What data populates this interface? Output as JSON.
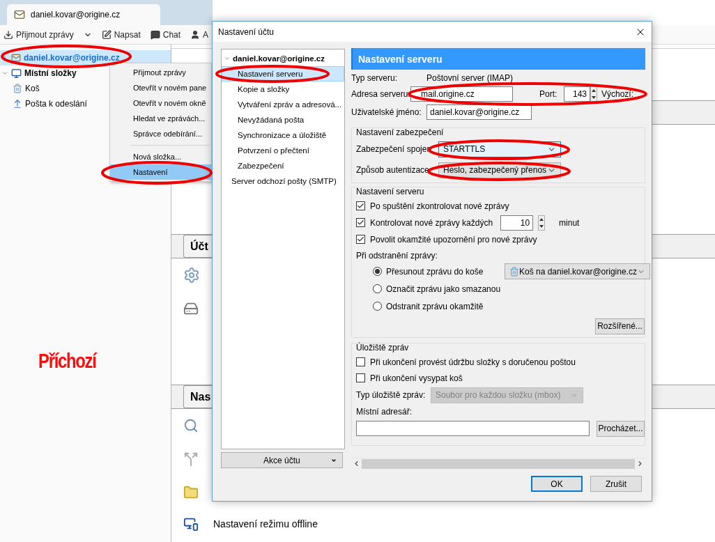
{
  "tab": {
    "title": "daniel.kovar@origine.cz"
  },
  "toolbar": [
    {
      "kind": "get",
      "label": "Přijmout zprávy"
    },
    {
      "kind": "menu"
    },
    {
      "kind": "write",
      "label": "Napsat"
    },
    {
      "kind": "chat",
      "label": "Chat"
    },
    {
      "kind": "contacts",
      "label": "A"
    }
  ],
  "folders": [
    {
      "kind": "account",
      "label": "daniel.kovar@origine.cz",
      "selected": true,
      "expanded": false
    },
    {
      "kind": "local",
      "label": "Místní složky",
      "selected": false,
      "expanded": true,
      "children": [
        {
          "kind": "trash",
          "label": "Koš",
          "selected": false
        },
        {
          "kind": "outbox",
          "label": "Pošta k odeslání",
          "selected": false
        }
      ]
    }
  ],
  "context_menu": [
    {
      "kind": "item",
      "label": "Přijmout zprávy",
      "selected": false
    },
    {
      "kind": "item",
      "label": "Otevřít v novém pane",
      "selected": false
    },
    {
      "kind": "item",
      "label": "Otevřít v novém okně",
      "selected": false
    },
    {
      "kind": "item",
      "label": "Hledat ve zprávách...",
      "selected": false
    },
    {
      "kind": "item",
      "label": "Správce odebírání...",
      "selected": false
    },
    {
      "kind": "separator"
    },
    {
      "kind": "item",
      "label": "Nová složka...",
      "selected": false
    },
    {
      "kind": "item",
      "label": "Nastavení",
      "selected": true
    }
  ],
  "content": {
    "sections": [
      "Účt",
      "Nas"
    ],
    "offline_link": "Nastavení režimu offline"
  },
  "annotation": "Příchozí",
  "dialog": {
    "title": "Nastavení účtu",
    "tree": {
      "account": "daniel.kovar@origine.cz",
      "expanded": true,
      "items": [
        {
          "label": "Nastavení serveru",
          "selected": true
        },
        {
          "label": "Kopie a složky",
          "selected": false
        },
        {
          "label": "Vytváření zpráv a adresová...",
          "selected": false
        },
        {
          "label": "Nevyžádaná pošta",
          "selected": false
        },
        {
          "label": "Synchronizace a úložiště",
          "selected": false
        },
        {
          "label": "Potvrzení o přečtení",
          "selected": false
        },
        {
          "label": "Zabezpečení",
          "selected": false
        }
      ],
      "other": "Server odchozí pošty (SMTP)"
    },
    "account_actions": "Akce účtu",
    "header": "Nastavení serveru",
    "server_type": {
      "label": "Typ serveru:",
      "value": "Poštovní server (IMAP)"
    },
    "server_address": {
      "label": "Adresa serveru:",
      "value": "mail.origine.cz"
    },
    "port": {
      "label": "Port:",
      "value": "143",
      "default_label": "Výchozí:"
    },
    "username": {
      "label": "Uživatelské jméno:",
      "value": "daniel.kovar@origine.cz"
    },
    "security": {
      "title": "Nastavení zabezpečení",
      "rows": [
        {
          "label": "Zabezpečení spojen",
          "value": "STARTTLS",
          "focused": true
        },
        {
          "label": "Způsob autentizace",
          "value": "Heslo, zabezpečený přenos",
          "focused": false
        }
      ]
    },
    "server_settings": {
      "title": "Nastavení serveru",
      "checks": [
        {
          "kind": "plain",
          "label": "Po spuštění zkontrolovat nové zprávy",
          "checked": true
        },
        {
          "kind": "interval",
          "label": "Kontrolovat nové zprávy každých",
          "checked": true,
          "value": "10",
          "unit": "minut"
        },
        {
          "kind": "plain",
          "label": "Povolit okamžité upozornění pro nové zprávy",
          "checked": true
        }
      ],
      "delete_label": "Při odstranění zprávy:",
      "delete_options": [
        {
          "label": "Přesunout zprávu do koše",
          "selected": true,
          "target": "Koš na daniel.kovar@origine.cz"
        },
        {
          "label": "Označit zprávu jako smazanou",
          "selected": false
        },
        {
          "label": "Odstranit zprávu okamžitě",
          "selected": false
        }
      ],
      "advanced": "Rozšířené..."
    },
    "storage": {
      "title": "Úložiště zpráv",
      "checks": [
        {
          "label": "Při ukončení provést údržbu složky s doručenou poštou",
          "checked": false
        },
        {
          "label": "Při ukončení vysypat koš",
          "checked": false
        }
      ],
      "type": {
        "label": "Typ úložiště zpráv:",
        "value": "Soubor pro každou složku (mbox)",
        "disabled": true
      },
      "local_dir_label": "Místní adresář:",
      "browse": "Procházet..."
    },
    "buttons": [
      {
        "label": "OK",
        "default": true
      },
      {
        "label": "Zrušit",
        "default": false
      }
    ]
  }
}
